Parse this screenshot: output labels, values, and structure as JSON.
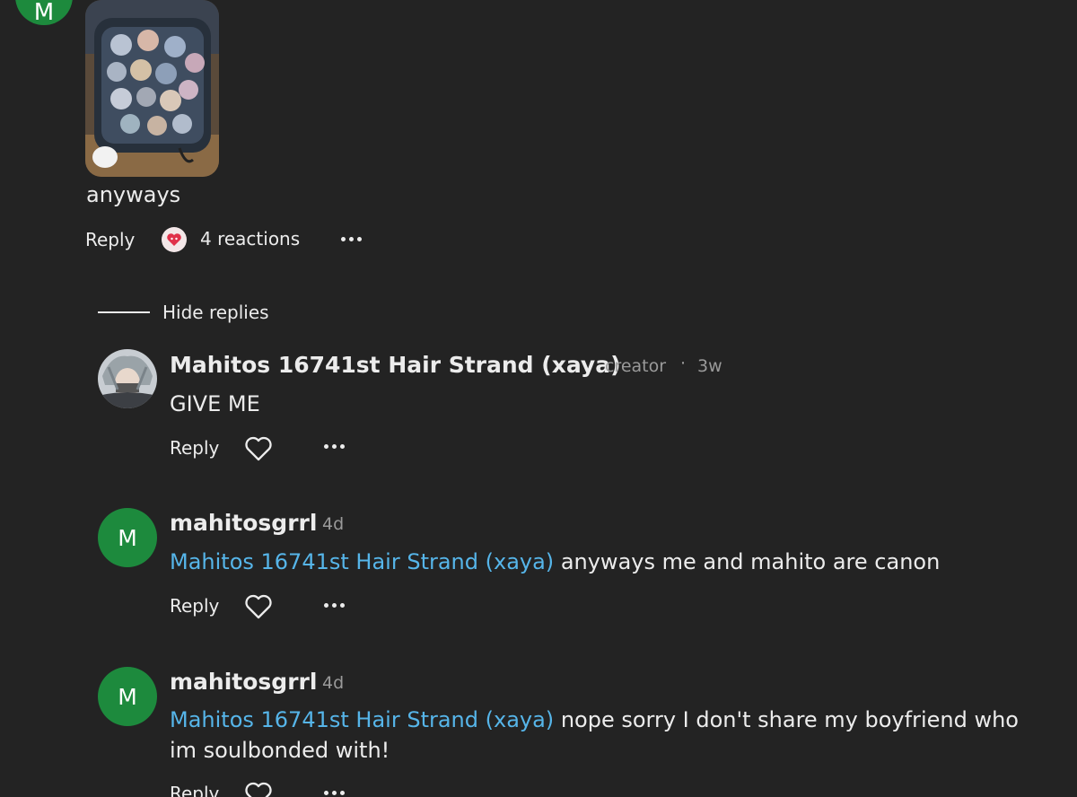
{
  "top_comment": {
    "avatar_letter": "M",
    "text": "anyways",
    "reply_label": "Reply",
    "reactions_label": "4 reactions",
    "reaction_icon": "heart-eyes-emoji-icon"
  },
  "thread": {
    "hide_replies_label": "Hide replies",
    "replies": [
      {
        "username": "Mahitos 16741st Hair Strand (xaya)",
        "role": "creator",
        "separator": "·",
        "time": "3w",
        "text": "GIVE ME",
        "reply_label": "Reply"
      },
      {
        "avatar_letter": "M",
        "username": "mahitosgrrl",
        "time": "4d",
        "mention": "Mahitos 16741st Hair Strand (xaya)",
        "text": "anyways me and mahito are canon",
        "reply_label": "Reply"
      },
      {
        "avatar_letter": "M",
        "username": "mahitosgrrl",
        "time": "4d",
        "mention": "Mahitos 16741st Hair Strand (xaya)",
        "text": "nope sorry I don't share my boyfriend who",
        "text_line2": "im soulbonded with!",
        "reply_label": "Reply"
      }
    ]
  },
  "colors": {
    "background": "#232323",
    "text": "#ececec",
    "mention": "#56b5e9",
    "avatar_green": "#1d8a3d",
    "meta_gray": "#9a9a9a"
  }
}
